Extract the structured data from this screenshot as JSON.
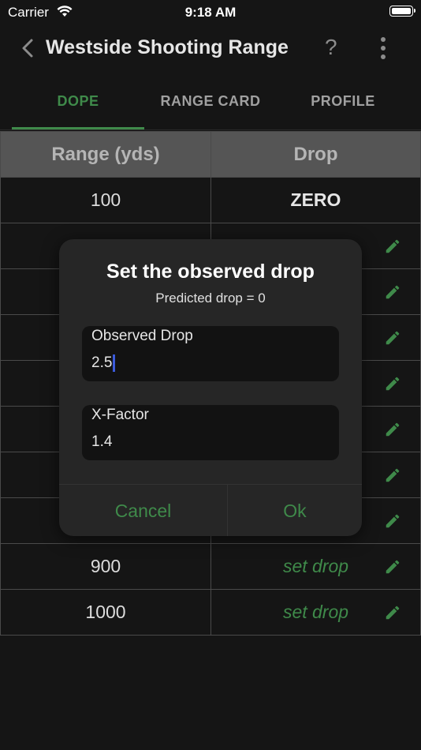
{
  "status": {
    "carrier": "Carrier",
    "time": "9:18 AM"
  },
  "appbar": {
    "title": "Westside Shooting Range",
    "help": "?"
  },
  "tabs": [
    "DOPE",
    "RANGE CARD",
    "PROFILE"
  ],
  "table": {
    "headers": {
      "range": "Range (yds)",
      "drop": "Drop"
    },
    "rows": [
      {
        "range": "100",
        "drop": "ZERO"
      },
      {
        "range": "",
        "drop": ""
      },
      {
        "range": "",
        "drop": ""
      },
      {
        "range": "",
        "drop": ""
      },
      {
        "range": "",
        "drop": ""
      },
      {
        "range": "",
        "drop": ""
      },
      {
        "range": "",
        "drop": ""
      },
      {
        "range": "",
        "drop": ""
      },
      {
        "range": "900",
        "drop": "set drop"
      },
      {
        "range": "1000",
        "drop": "set drop"
      }
    ]
  },
  "dialog": {
    "title": "Set the observed drop",
    "subtitle": "Predicted drop = 0",
    "observed_label": "Observed Drop",
    "observed_value": "2.5",
    "xfactor_label": "X-Factor",
    "xfactor_value": "1.4",
    "cancel": "Cancel",
    "ok": "Ok"
  },
  "colors": {
    "accent": "#3f8a4a",
    "background": "#151515",
    "header": "#555555"
  }
}
